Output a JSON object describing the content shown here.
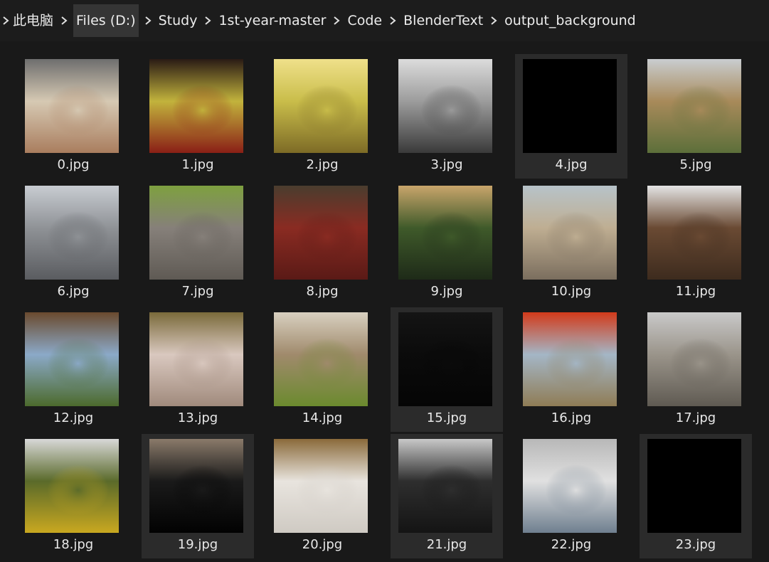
{
  "breadcrumb": {
    "items": [
      "此电脑",
      "Files (D:)",
      "Study",
      "1st-year-master",
      "Code",
      "BlenderText",
      "output_background"
    ],
    "active_index": 1
  },
  "files": [
    {
      "name": "0.jpg",
      "selected": false,
      "colors": [
        "#a97d5e",
        "#d6c9b3",
        "#6e6e6e"
      ]
    },
    {
      "name": "1.jpg",
      "selected": false,
      "colors": [
        "#8a1f16",
        "#c2b33c",
        "#2a1b15"
      ]
    },
    {
      "name": "2.jpg",
      "selected": false,
      "colors": [
        "#7d6b26",
        "#c9bd4a",
        "#efe08a"
      ]
    },
    {
      "name": "3.jpg",
      "selected": false,
      "colors": [
        "#3a3a3a",
        "#9c9c9c",
        "#dcdcdc"
      ]
    },
    {
      "name": "4.jpg",
      "selected": true,
      "colors": [
        "#000000",
        "#000000",
        "#000000"
      ]
    },
    {
      "name": "5.jpg",
      "selected": false,
      "colors": [
        "#5c6f3a",
        "#a88a5a",
        "#c9cdd0"
      ]
    },
    {
      "name": "6.jpg",
      "selected": false,
      "colors": [
        "#5a5c60",
        "#8f9296",
        "#c8ccd2"
      ]
    },
    {
      "name": "7.jpg",
      "selected": false,
      "colors": [
        "#5f5a54",
        "#86807a",
        "#7ea03f"
      ]
    },
    {
      "name": "8.jpg",
      "selected": false,
      "colors": [
        "#5a1a16",
        "#8a2b22",
        "#4a3d2e"
      ]
    },
    {
      "name": "9.jpg",
      "selected": false,
      "colors": [
        "#1e2a18",
        "#3f5a2a",
        "#c9a56b"
      ]
    },
    {
      "name": "10.jpg",
      "selected": false,
      "colors": [
        "#7b6e5e",
        "#bfae92",
        "#b7c3c9"
      ]
    },
    {
      "name": "11.jpg",
      "selected": false,
      "colors": [
        "#3d2b1e",
        "#6a4a33",
        "#e4e4e4"
      ]
    },
    {
      "name": "12.jpg",
      "selected": false,
      "colors": [
        "#4c6a2c",
        "#8ba9c8",
        "#6a4a2e"
      ]
    },
    {
      "name": "13.jpg",
      "selected": false,
      "colors": [
        "#a08a7c",
        "#d9c8bf",
        "#7a6a3a"
      ]
    },
    {
      "name": "14.jpg",
      "selected": false,
      "colors": [
        "#6b8a2e",
        "#a08a6c",
        "#d8d0c0"
      ]
    },
    {
      "name": "15.jpg",
      "selected": true,
      "colors": [
        "#050505",
        "#0b0b0b",
        "#141414"
      ]
    },
    {
      "name": "16.jpg",
      "selected": false,
      "colors": [
        "#8f7c55",
        "#a4b6c6",
        "#d23a1a"
      ]
    },
    {
      "name": "17.jpg",
      "selected": false,
      "colors": [
        "#5f5a52",
        "#9a948a",
        "#c9c9c9"
      ]
    },
    {
      "name": "18.jpg",
      "selected": false,
      "colors": [
        "#c9a820",
        "#5a6a2a",
        "#d8d8d8"
      ]
    },
    {
      "name": "19.jpg",
      "selected": true,
      "colors": [
        "#020202",
        "#1a1a1a",
        "#8a7a6a"
      ]
    },
    {
      "name": "20.jpg",
      "selected": false,
      "colors": [
        "#cfcac3",
        "#e8e4de",
        "#8a6a3a"
      ]
    },
    {
      "name": "21.jpg",
      "selected": true,
      "colors": [
        "#141414",
        "#2e2e2e",
        "#c8c8c8"
      ]
    },
    {
      "name": "22.jpg",
      "selected": false,
      "colors": [
        "#6f7f8f",
        "#e0e0e0",
        "#b8b8b8"
      ]
    },
    {
      "name": "23.jpg",
      "selected": true,
      "colors": [
        "#000000",
        "#000000",
        "#000000"
      ]
    }
  ],
  "icons": {
    "separator": "chevron-right-icon"
  }
}
